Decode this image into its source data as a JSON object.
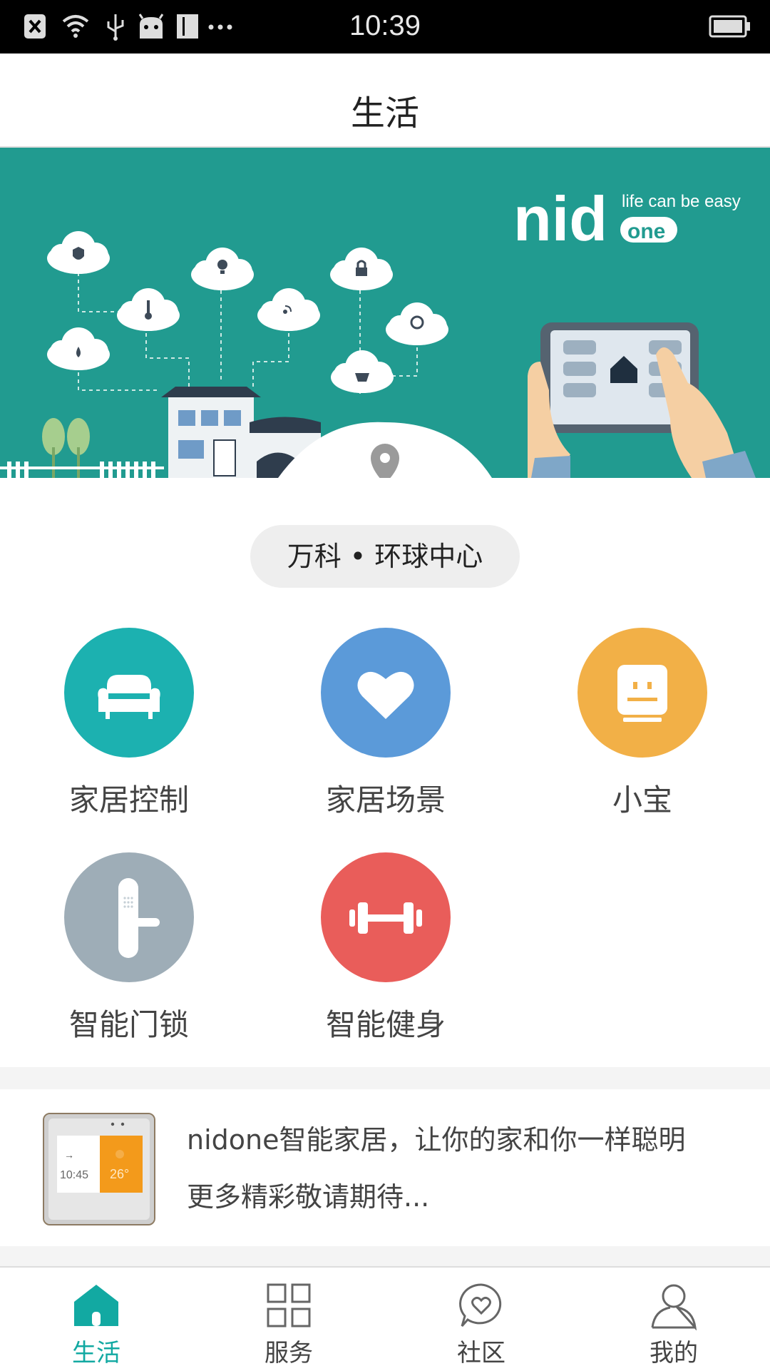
{
  "status_bar": {
    "time": "10:39"
  },
  "header": {
    "title": "生活"
  },
  "banner": {
    "brand": "nid",
    "brand_sub": "one",
    "tagline": "life can be easy"
  },
  "location": {
    "label": "万科 • 环球中心"
  },
  "features": [
    {
      "label": "家居控制",
      "icon": "sofa-icon",
      "color": "#1cb1b0"
    },
    {
      "label": "家居场景",
      "icon": "heart-icon",
      "color": "#5b9ad9"
    },
    {
      "label": "小宝",
      "icon": "robot-icon",
      "color": "#f2b047"
    },
    {
      "label": "智能门锁",
      "icon": "door-lock-icon",
      "color": "#9eadb7"
    },
    {
      "label": "智能健身",
      "icon": "dumbbell-icon",
      "color": "#e95d5a"
    }
  ],
  "article": {
    "line1": "nidone智能家居，让你的家和你一样聪明",
    "line2": "更多精彩敬请期待...",
    "thumb_time": "10:45",
    "thumb_temp": "26°"
  },
  "tabs": [
    {
      "label": "生活",
      "icon": "home-icon",
      "active": true
    },
    {
      "label": "服务",
      "icon": "grid-icon",
      "active": false
    },
    {
      "label": "社区",
      "icon": "chat-heart-icon",
      "active": false
    },
    {
      "label": "我的",
      "icon": "person-icon",
      "active": false
    }
  ],
  "colors": {
    "accent": "#12a9a2",
    "banner_bg": "#219b90"
  }
}
